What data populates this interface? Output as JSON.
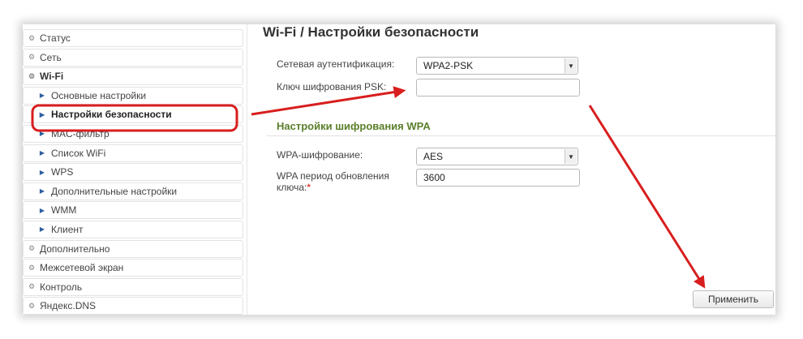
{
  "sidebar": {
    "items": [
      {
        "label": "Статус",
        "icon": "gear-icon"
      },
      {
        "label": "Сеть",
        "icon": "gear-icon"
      },
      {
        "label": "Wi-Fi",
        "icon": "gear-open-icon"
      },
      {
        "label": "Основные настройки",
        "icon": "chevron-right-icon"
      },
      {
        "label": "Настройки безопасности",
        "icon": "chevron-right-icon"
      },
      {
        "label": "MAC-фильтр",
        "icon": "chevron-right-icon"
      },
      {
        "label": "Список WiFi",
        "icon": "chevron-right-icon"
      },
      {
        "label": "WPS",
        "icon": "chevron-right-icon"
      },
      {
        "label": "Дополнительные настройки",
        "icon": "chevron-right-icon"
      },
      {
        "label": "WMM",
        "icon": "chevron-right-icon"
      },
      {
        "label": "Клиент",
        "icon": "chevron-right-icon"
      },
      {
        "label": "Дополнительно",
        "icon": "gear-icon"
      },
      {
        "label": "Межсетевой экран",
        "icon": "gear-icon"
      },
      {
        "label": "Контроль",
        "icon": "gear-icon"
      },
      {
        "label": "Яндекс.DNS",
        "icon": "gear-icon"
      }
    ]
  },
  "page": {
    "title": "Wi-Fi /  Настройки безопасности"
  },
  "auth": {
    "label": "Сетевая аутентификация:",
    "value": "WPA2-PSK"
  },
  "psk": {
    "label": "Ключ шифрования PSK:",
    "value": ""
  },
  "wpa_section": {
    "title": "Настройки шифрования WPA",
    "cipher_label": "WPA-шифрование:",
    "cipher_value": "AES",
    "period_label_line1": "WPA период обновления",
    "period_label_line2": "ключа:",
    "period_required": "*",
    "period_value": "3600"
  },
  "actions": {
    "apply_label": "Применить"
  },
  "colors": {
    "annotation_red": "#d81e1e",
    "section_title_green": "#5a7f2a"
  }
}
